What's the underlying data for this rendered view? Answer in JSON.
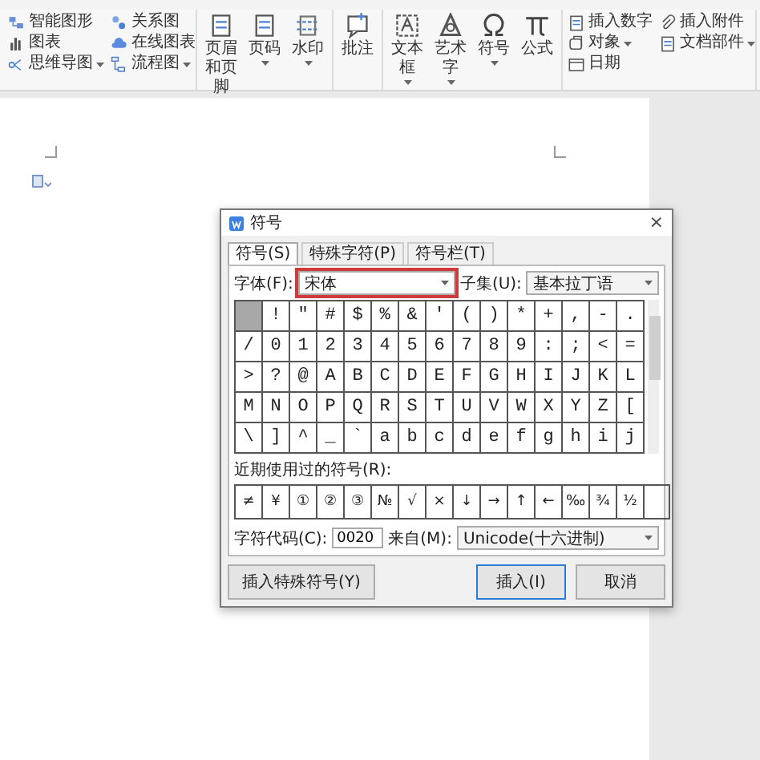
{
  "ribbon": {
    "groups": [
      {
        "kind": "small",
        "items": [
          {
            "label": "智能图形",
            "kind": "shapes",
            "dropdown": false
          },
          {
            "label": "图表",
            "kind": "chart",
            "dropdown": false
          },
          {
            "label": "思维导图",
            "kind": "mindmap",
            "dropdown": true
          },
          {
            "label": "关系图",
            "kind": "relation",
            "dropdown": false
          },
          {
            "label": "在线图表",
            "kind": "cloud",
            "dropdown": false
          },
          {
            "label": "流程图",
            "kind": "flow",
            "dropdown": true
          }
        ]
      },
      {
        "kind": "big",
        "items": [
          {
            "label": "页眉和页脚",
            "kind": "doc",
            "dropdown": false
          },
          {
            "label": "页码",
            "kind": "doc",
            "dropdown": true
          },
          {
            "label": "水印",
            "kind": "watermark",
            "dropdown": true
          }
        ]
      },
      {
        "kind": "big",
        "items": [
          {
            "label": "批注",
            "kind": "comment",
            "dropdown": false
          }
        ]
      },
      {
        "kind": "big",
        "items": [
          {
            "label": "文本框",
            "kind": "textbox",
            "dropdown": true
          },
          {
            "label": "艺术字",
            "kind": "art",
            "dropdown": true
          },
          {
            "label": "符号",
            "kind": "omega",
            "dropdown": true
          },
          {
            "label": "公式",
            "kind": "pi",
            "dropdown": false
          }
        ]
      },
      {
        "kind": "small",
        "items": [
          {
            "label": "插入数字",
            "kind": "doc",
            "dropdown": false
          },
          {
            "label": "对象",
            "kind": "object",
            "dropdown": true
          },
          {
            "label": "日期",
            "kind": "calendar",
            "dropdown": false
          },
          {
            "label": "插入附件",
            "kind": "clip",
            "dropdown": false
          },
          {
            "label": "文档部件",
            "kind": "doc",
            "dropdown": true
          }
        ]
      }
    ]
  },
  "dialog": {
    "title": "符号",
    "close": "×",
    "tabs": [
      {
        "label": "符号(S)",
        "selected": true
      },
      {
        "label": "特殊字符(P)",
        "selected": false
      },
      {
        "label": "符号栏(T)",
        "selected": false
      }
    ],
    "font": {
      "label": "字体(F):",
      "value": "宋体",
      "highlighted": true
    },
    "subset": {
      "label": "子集(U):",
      "value": "基本拉丁语"
    },
    "cells": [
      {
        "selected": true
      },
      {
        "char": "!",
        "selected": false
      },
      {
        "char": "\"",
        "selected": false
      },
      {
        "char": "#",
        "selected": false
      },
      {
        "char": "$",
        "selected": false
      },
      {
        "char": "%",
        "selected": false
      },
      {
        "char": "&",
        "selected": false
      },
      {
        "char": "'",
        "selected": false
      },
      {
        "char": "(",
        "selected": false
      },
      {
        "char": ")",
        "selected": false
      },
      {
        "char": "*",
        "selected": false
      },
      {
        "char": "+",
        "selected": false
      },
      {
        "char": ",",
        "selected": false
      },
      {
        "char": "-",
        "selected": false
      },
      {
        "char": ".",
        "selected": false
      },
      {
        "char": "/",
        "selected": false
      },
      {
        "char": "0",
        "selected": false
      },
      {
        "char": "1",
        "selected": false
      },
      {
        "char": "2",
        "selected": false
      },
      {
        "char": "3",
        "selected": false
      },
      {
        "char": "4",
        "selected": false
      },
      {
        "char": "5",
        "selected": false
      },
      {
        "char": "6",
        "selected": false
      },
      {
        "char": "7",
        "selected": false
      },
      {
        "char": "8",
        "selected": false
      },
      {
        "char": "9",
        "selected": false
      },
      {
        "char": ":",
        "selected": false
      },
      {
        "char": ";",
        "selected": false
      },
      {
        "char": "<",
        "selected": false
      },
      {
        "char": "=",
        "selected": false
      },
      {
        "char": ">",
        "selected": false
      },
      {
        "char": "?",
        "selected": false
      },
      {
        "char": "@",
        "selected": false
      },
      {
        "char": "A",
        "selected": false
      },
      {
        "char": "B",
        "selected": false
      },
      {
        "char": "C",
        "selected": false
      },
      {
        "char": "D",
        "selected": false
      },
      {
        "char": "E",
        "selected": false
      },
      {
        "char": "F",
        "selected": false
      },
      {
        "char": "G",
        "selected": false
      },
      {
        "char": "H",
        "selected": false
      },
      {
        "char": "I",
        "selected": false
      },
      {
        "char": "J",
        "selected": false
      },
      {
        "char": "K",
        "selected": false
      },
      {
        "char": "L",
        "selected": false
      },
      {
        "char": "M",
        "selected": false
      },
      {
        "char": "N",
        "selected": false
      },
      {
        "char": "O",
        "selected": false
      },
      {
        "char": "P",
        "selected": false
      },
      {
        "char": "Q",
        "selected": false
      },
      {
        "char": "R",
        "selected": false
      },
      {
        "char": "S",
        "selected": false
      },
      {
        "char": "T",
        "selected": false
      },
      {
        "char": "U",
        "selected": false
      },
      {
        "char": "V",
        "selected": false
      },
      {
        "char": "W",
        "selected": false
      },
      {
        "char": "X",
        "selected": false
      },
      {
        "char": "Y",
        "selected": false
      },
      {
        "char": "Z",
        "selected": false
      },
      {
        "char": "[",
        "selected": false
      },
      {
        "char": "\\",
        "selected": false
      },
      {
        "char": "]",
        "selected": false
      },
      {
        "char": "^",
        "selected": false
      },
      {
        "char": "_",
        "selected": false
      },
      {
        "char": "`",
        "selected": false
      },
      {
        "char": "a",
        "selected": false
      },
      {
        "char": "b",
        "selected": false
      },
      {
        "char": "c",
        "selected": false
      },
      {
        "char": "d",
        "selected": false
      },
      {
        "char": "e",
        "selected": false
      },
      {
        "char": "f",
        "selected": false
      },
      {
        "char": "g",
        "selected": false
      },
      {
        "char": "h",
        "selected": false
      },
      {
        "char": "i",
        "selected": false
      },
      {
        "char": "j",
        "selected": false
      }
    ],
    "recent_label": "近期使用过的符号(R):",
    "recent": [
      "≠",
      "¥",
      "①",
      "②",
      "③",
      "№",
      "√",
      "×",
      "↓",
      "→",
      "↑",
      "←",
      "‰",
      "¾",
      "½"
    ],
    "code": {
      "label": "字符代码(C):",
      "value": "0020"
    },
    "from": {
      "label": "来自(M):",
      "value": "Unicode(十六进制)"
    },
    "buttons": [
      {
        "label": "插入特殊符号(Y)",
        "kind": "secondary"
      },
      {
        "label": "插入(I)",
        "kind": "default"
      },
      {
        "label": "取消",
        "kind": "normal"
      }
    ]
  }
}
